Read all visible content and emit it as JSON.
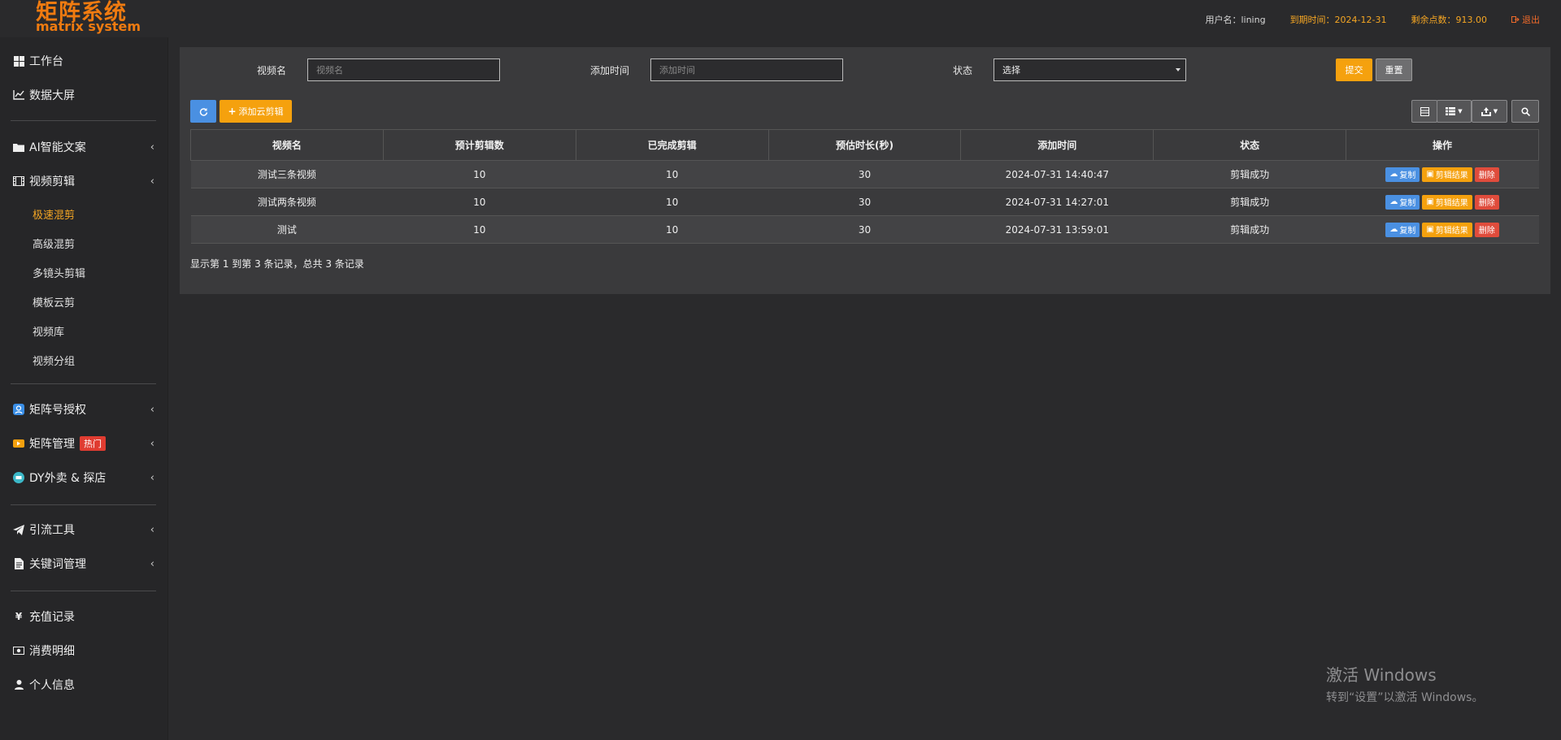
{
  "app": {
    "logo_cn": "矩阵系统",
    "logo_en": "matrix system",
    "brand_color": "#f07b10",
    "accent_color": "#f5a623"
  },
  "header": {
    "username": "用户名：lining",
    "expire": "到期时间：2024-12-31",
    "points": "剩余点数：913.00",
    "logout": "退出"
  },
  "sidebar": {
    "workbench": "工作台",
    "datascreen": "数据大屏",
    "ai_copy": "AI智能文案",
    "video_edit": "视频剪辑",
    "sub": {
      "fast": "极速混剪",
      "advanced": "高级混剪",
      "multicam": "多镜头剪辑",
      "template": "模板云剪",
      "library": "视频库",
      "group": "视频分组"
    },
    "matrix_auth": "矩阵号授权",
    "matrix_manage": "矩阵管理",
    "hot": "热门",
    "dy": "DY外卖 & 探店",
    "traffic": "引流工具",
    "keywords": "关键词管理",
    "recharge": "充值记录",
    "consume": "消费明细",
    "profile": "个人信息"
  },
  "filters": {
    "name_label": "视频名",
    "name_placeholder": "视频名",
    "time_label": "添加时间",
    "time_placeholder": "添加时间",
    "status_label": "状态",
    "status_value": "选择",
    "submit": "提交",
    "reset": "重置"
  },
  "toolbar": {
    "add": "添加云剪辑"
  },
  "table": {
    "headers": [
      "视频名",
      "预计剪辑数",
      "已完成剪辑",
      "预估时长(秒)",
      "添加时间",
      "状态",
      "操作"
    ],
    "rows": [
      {
        "name": "测试三条视频",
        "planned": "10",
        "done": "10",
        "duration": "30",
        "time": "2024-07-31 14:40:47",
        "status": "剪辑成功"
      },
      {
        "name": "测试两条视频",
        "planned": "10",
        "done": "10",
        "duration": "30",
        "time": "2024-07-31 14:27:01",
        "status": "剪辑成功"
      },
      {
        "name": "测试",
        "planned": "10",
        "done": "10",
        "duration": "30",
        "time": "2024-07-31 13:59:01",
        "status": "剪辑成功"
      }
    ],
    "op_copy": "复制",
    "op_result": "剪辑结果",
    "op_delete": "删除"
  },
  "pagination": {
    "summary": "显示第 1 到第 3 条记录，总共 3 条记录"
  },
  "watermark": {
    "line1": "激活 Windows",
    "line2": "转到“设置”以激活 Windows。"
  }
}
